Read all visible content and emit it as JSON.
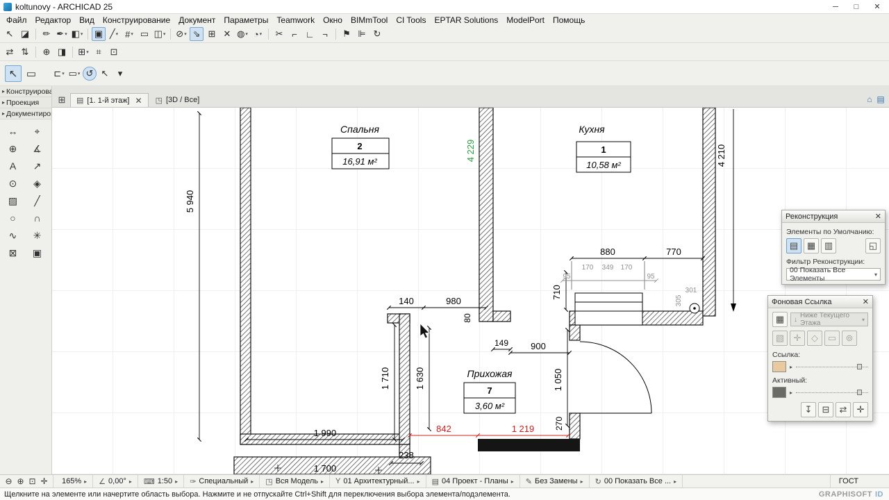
{
  "window": {
    "title": "koltunovy - ARCHICAD 25",
    "controls": [
      {
        "g": "─",
        "n": "minimize-button"
      },
      {
        "g": "□",
        "n": "maximize-button"
      },
      {
        "g": "✕",
        "n": "close-button"
      }
    ]
  },
  "menu": {
    "items": [
      {
        "label": "Файл",
        "n": "menu-file"
      },
      {
        "label": "Редактор",
        "n": "menu-editor"
      },
      {
        "label": "Вид",
        "n": "menu-view"
      },
      {
        "label": "Конструирование",
        "n": "menu-design"
      },
      {
        "label": "Документ",
        "n": "menu-document"
      },
      {
        "label": "Параметры",
        "n": "menu-options"
      },
      {
        "label": "Teamwork",
        "n": "menu-teamwork"
      },
      {
        "label": "Окно",
        "n": "menu-window"
      },
      {
        "label": "BIMmTool",
        "n": "menu-bimmtool"
      },
      {
        "label": "CI Tools",
        "n": "menu-citools"
      },
      {
        "label": "EPTAR Solutions",
        "n": "menu-eptar"
      },
      {
        "label": "ModelPort",
        "n": "menu-modelport"
      },
      {
        "label": "Помощь",
        "n": "menu-help"
      }
    ]
  },
  "toolbars": {
    "row1": [
      {
        "g": "↖",
        "c": "tbi",
        "n": "arrow-tool-icon",
        "i": "true"
      },
      {
        "g": "◪",
        "c": "tbi",
        "n": "eraser-icon",
        "i": "true"
      },
      {
        "g": "",
        "c": "sep",
        "n": "separator",
        "i": "false"
      },
      {
        "g": "✏",
        "c": "tbi",
        "n": "pencil-icon",
        "i": "true"
      },
      {
        "g": "✒",
        "c": "tbi dd",
        "n": "pen-icon",
        "i": "true"
      },
      {
        "g": "◧",
        "c": "tbi dd",
        "n": "fill-icon",
        "i": "true"
      },
      {
        "g": "",
        "c": "sep",
        "n": "separator",
        "i": "false"
      },
      {
        "g": "▣",
        "c": "tbi sel",
        "n": "wall-tool-icon",
        "i": "true"
      },
      {
        "g": "╱",
        "c": "tbi dd",
        "n": "line-type-icon",
        "i": "true"
      },
      {
        "g": "#",
        "c": "tbi dd",
        "n": "grid-snap-icon",
        "i": "true"
      },
      {
        "g": "▭",
        "c": "tbi",
        "n": "marquee-icon",
        "i": "true"
      },
      {
        "g": "◫",
        "c": "tbi dd",
        "n": "panel-icon",
        "i": "true"
      },
      {
        "g": "",
        "c": "sep",
        "n": "separator",
        "i": "false"
      },
      {
        "g": "⊘",
        "c": "tbi dd",
        "n": "lock-icon",
        "i": "true"
      },
      {
        "g": "⇘",
        "c": "tbi sel",
        "n": "gravity-icon",
        "i": "true"
      },
      {
        "g": "⊞",
        "c": "tbi",
        "n": "coordinate-grid-icon",
        "i": "true"
      },
      {
        "g": "✕",
        "c": "tbi",
        "n": "intersection-icon",
        "i": "true"
      },
      {
        "g": "◍",
        "c": "tbi dd",
        "n": "shapes-icon",
        "i": "true"
      },
      {
        "g": "◔",
        "c": "tbi dd",
        "n": "arc-segment-icon",
        "i": "true"
      },
      {
        "g": "",
        "c": "sep",
        "n": "separator",
        "i": "false"
      },
      {
        "g": "✂",
        "c": "tbi",
        "n": "split-icon",
        "i": "true"
      },
      {
        "g": "⌐",
        "c": "tbi",
        "n": "adjust-icon",
        "i": "true"
      },
      {
        "g": "∟",
        "c": "tbi",
        "n": "corner-icon",
        "i": "true"
      },
      {
        "g": "¬",
        "c": "tbi",
        "n": "offset-icon",
        "i": "true"
      },
      {
        "g": "",
        "c": "sep",
        "n": "separator",
        "i": "false"
      },
      {
        "g": "⚑",
        "c": "tbi",
        "n": "flag-icon",
        "i": "true"
      },
      {
        "g": "⊫",
        "c": "tbi",
        "n": "align-icon",
        "i": "true"
      },
      {
        "g": "↻",
        "c": "tbi",
        "n": "rotate-icon",
        "i": "true"
      }
    ],
    "row2": [
      {
        "g": "⇄",
        "c": "tbi",
        "n": "swap-icon",
        "i": "true"
      },
      {
        "g": "⇅",
        "c": "tbi",
        "n": "transfer-icon",
        "i": "true"
      },
      {
        "g": "",
        "c": "sep",
        "n": "separator",
        "i": "false"
      },
      {
        "g": "⊕",
        "c": "tbi",
        "n": "add-marker-icon",
        "i": "true"
      },
      {
        "g": "◨",
        "c": "tbi",
        "n": "half-plan-icon",
        "i": "true"
      },
      {
        "g": "",
        "c": "sep",
        "n": "separator",
        "i": "false"
      },
      {
        "g": "⊞",
        "c": "tbi dd",
        "n": "layout-grid-icon",
        "i": "true"
      },
      {
        "g": "⌗",
        "c": "tbi",
        "n": "module-icon",
        "i": "true"
      },
      {
        "g": "⊡",
        "c": "tbi",
        "n": "frame-icon",
        "i": "true"
      }
    ],
    "row3": [
      {
        "g": "↖",
        "c": "tbi big sel",
        "n": "pointer-tool-icon",
        "i": "true"
      },
      {
        "g": "▭",
        "c": "tbi big",
        "n": "marquee-tool-icon",
        "i": "true"
      },
      {
        "g": "",
        "c": "gap",
        "n": "spacer",
        "i": "false"
      },
      {
        "g": "⊏",
        "c": "tbi dd",
        "n": "selection-mode-icon",
        "i": "true"
      },
      {
        "g": "▭",
        "c": "tbi dd",
        "n": "selection-shape-icon",
        "i": "true"
      },
      {
        "g": "↺",
        "c": "tbi sel round",
        "n": "rotate-view-icon",
        "i": "true"
      },
      {
        "g": "↖",
        "c": "tbi",
        "n": "cursor-mode-icon",
        "i": "true"
      },
      {
        "g": "▾",
        "c": "tbi",
        "n": "more-options-icon",
        "i": "true"
      }
    ]
  },
  "sidebar": {
    "sections": [
      {
        "car": "▸",
        "label": "Конструирова",
        "n": "sidebar-section-design"
      },
      {
        "car": "▸",
        "label": "Проекция",
        "n": "sidebar-section-projection"
      },
      {
        "car": "▸",
        "label": "Документирова",
        "n": "sidebar-section-documentation"
      }
    ],
    "tools": [
      {
        "g": "↔",
        "n": "dimension-tool-icon"
      },
      {
        "g": "⌖",
        "n": "level-dimension-tool-icon"
      },
      {
        "g": "⊕",
        "n": "hotspot-tool-icon"
      },
      {
        "g": "∡",
        "n": "angle-dimension-tool-icon"
      },
      {
        "g": "A",
        "n": "text-tool-icon"
      },
      {
        "g": "↗",
        "n": "label-tool-icon"
      },
      {
        "g": "⊙",
        "n": "column-symbol-tool-icon"
      },
      {
        "g": "◈",
        "n": "zone-tool-icon"
      },
      {
        "g": "▨",
        "n": "fill-tool-icon"
      },
      {
        "g": "╱",
        "n": "line-tool-icon"
      },
      {
        "g": "○",
        "n": "circle-tool-icon"
      },
      {
        "g": "∩",
        "n": "arc-tool-icon"
      },
      {
        "g": "∿",
        "n": "spline-tool-icon"
      },
      {
        "g": "✳",
        "n": "hotlink-tool-icon"
      },
      {
        "g": "⊠",
        "n": "figure-tool-icon"
      },
      {
        "g": "▣",
        "n": "drawing-tool-icon"
      }
    ]
  },
  "tabbar": {
    "quick_icon": "⊞",
    "active_tab": {
      "icon": "▤",
      "label": "[1. 1-й этаж]",
      "close": "✕"
    },
    "secondary_tab": {
      "icon": "◳",
      "label": "[3D / Все]"
    },
    "right_icons": [
      {
        "g": "⌂",
        "n": "model-view-icon"
      },
      {
        "g": "▤",
        "n": "layouts-icon"
      }
    ]
  },
  "plan": {
    "rooms": [
      {
        "name": "Спальня",
        "number": "2",
        "area": "16,91 м²"
      },
      {
        "name": "Кухня",
        "number": "1",
        "area": "10,58 м²"
      },
      {
        "name": "Прихожая",
        "number": "7",
        "area": "3,60 м²"
      }
    ],
    "dims": {
      "left_height": "5 940",
      "green_axis": "4 229",
      "right_height": "4 210",
      "w880": "880",
      "w770": "770",
      "g170a": "170",
      "g349": "349",
      "g170b": "170",
      "g95a": "95",
      "g95b": "95",
      "d140": "140",
      "d980": "980",
      "d80": "80",
      "d149": "149",
      "d900": "900",
      "d710": "710",
      "g301": "301",
      "g305": "305",
      "d1710": "1 710",
      "d1630": "1 630",
      "d1050": "1 050",
      "d1990": "1 990",
      "d842": "842",
      "d1219": "1 219",
      "d270": "270",
      "d238": "238",
      "d1700": "1 700"
    },
    "colors": {
      "green": "#2f9e44",
      "red": "#cc2020",
      "gray": "#8f8f8f"
    }
  },
  "palettes": {
    "reconstruction": {
      "title": "Реконструкция",
      "close": "✕",
      "defaults_label": "Элементы по Умолчанию:",
      "filter_label": "Фильтр Реконструкции:",
      "filter_value": "00 Показать Все Элементы",
      "icons": [
        {
          "g": "▤",
          "c": "pbi sel",
          "n": "existing-elements-icon",
          "i": "true"
        },
        {
          "g": "▦",
          "c": "pbi",
          "n": "demolished-elements-icon",
          "i": "true"
        },
        {
          "g": "▥",
          "c": "pbi",
          "n": "new-elements-icon",
          "i": "true"
        },
        {
          "g": "",
          "c": "pgap",
          "n": "spacer",
          "i": "false"
        },
        {
          "g": "◱",
          "c": "pbi",
          "n": "renovation-options-icon",
          "i": "true"
        }
      ]
    },
    "trace": {
      "title": "Фоновая Ссылка",
      "close": "✕",
      "big_icon": "▦",
      "ref_icon": "↓",
      "reference_value": "Ниже Текущего Этажа",
      "link_label": "Ссылка:",
      "active_label": "Активный:",
      "tool_icons": [
        {
          "g": "▧",
          "c": "pbi dis",
          "n": "trace-switch-icon",
          "i": "true"
        },
        {
          "g": "✛",
          "c": "pbi dis",
          "n": "move-reference-icon",
          "i": "true"
        },
        {
          "g": "◇",
          "c": "pbi dis",
          "n": "rotate-reference-icon",
          "i": "true"
        },
        {
          "g": "▭",
          "c": "pbi dis",
          "n": "reset-reference-icon",
          "i": "true"
        },
        {
          "g": "⊚",
          "c": "pbi dis",
          "n": "explore-reference-icon",
          "i": "true"
        }
      ],
      "bottom_icons": [
        {
          "g": "↧",
          "c": "pbi",
          "n": "switch-reference-active-icon",
          "i": "true"
        },
        {
          "g": "⊟",
          "c": "pbi",
          "n": "make-reference-icon",
          "i": "true"
        },
        {
          "g": "⇄",
          "c": "pbi",
          "n": "swap-reference-icon",
          "i": "true"
        },
        {
          "g": "✛",
          "c": "pbi",
          "n": "more-trace-options-icon",
          "i": "true"
        }
      ]
    }
  },
  "statusbar": {
    "zoom_icons": [
      {
        "g": "⊖",
        "n": "zoom-out-icon"
      },
      {
        "g": "⊕",
        "n": "zoom-in-icon"
      },
      {
        "g": "⊡",
        "n": "fit-in-window-icon"
      },
      {
        "g": "✛",
        "n": "pan-icon"
      }
    ],
    "segments": [
      {
        "ic": "",
        "label": "165%",
        "ar": "▸",
        "n": "zoom-level-selector",
        "c": "seg"
      },
      {
        "ic": "∠",
        "label": "0,00°",
        "ar": "▸",
        "n": "orientation-selector",
        "c": "seg"
      },
      {
        "ic": "⌨",
        "label": "1:50",
        "ar": "▸",
        "n": "scale-selector",
        "c": "seg"
      },
      {
        "ic": "✑",
        "label": "Специальный",
        "ar": "▸",
        "n": "pen-set-selector",
        "c": "seg"
      },
      {
        "ic": "◳",
        "label": "Вся Модель",
        "ar": "▸",
        "n": "partial-structure-selector",
        "c": "seg"
      },
      {
        "ic": "Y",
        "label": "01 Архитектурный...",
        "ar": "▸",
        "n": "layer-combination-selector",
        "c": "seg"
      },
      {
        "ic": "▤",
        "label": "04 Проект - Планы",
        "ar": "▸",
        "n": "dimension-standard-selector",
        "c": "seg"
      },
      {
        "ic": "✎",
        "label": "Без Замены",
        "ar": "▸",
        "n": "graphic-override-selector",
        "c": "seg"
      },
      {
        "ic": "↻",
        "label": "00 Показать Все ...",
        "ar": "▸",
        "n": "renovation-filter-selector",
        "c": "seg"
      },
      {
        "ic": "",
        "label": "ГОСТ",
        "ar": "",
        "n": "standard-indicator",
        "c": "seg last"
      }
    ]
  },
  "hintbar": {
    "text": "Щелкните на элементе или начертите область выбора. Нажмите и не отпускайте Ctrl+Shift для переключения выбора элемента/подэлемента.",
    "brand": "GRAPHISOFT",
    "brand_id": "ID"
  }
}
